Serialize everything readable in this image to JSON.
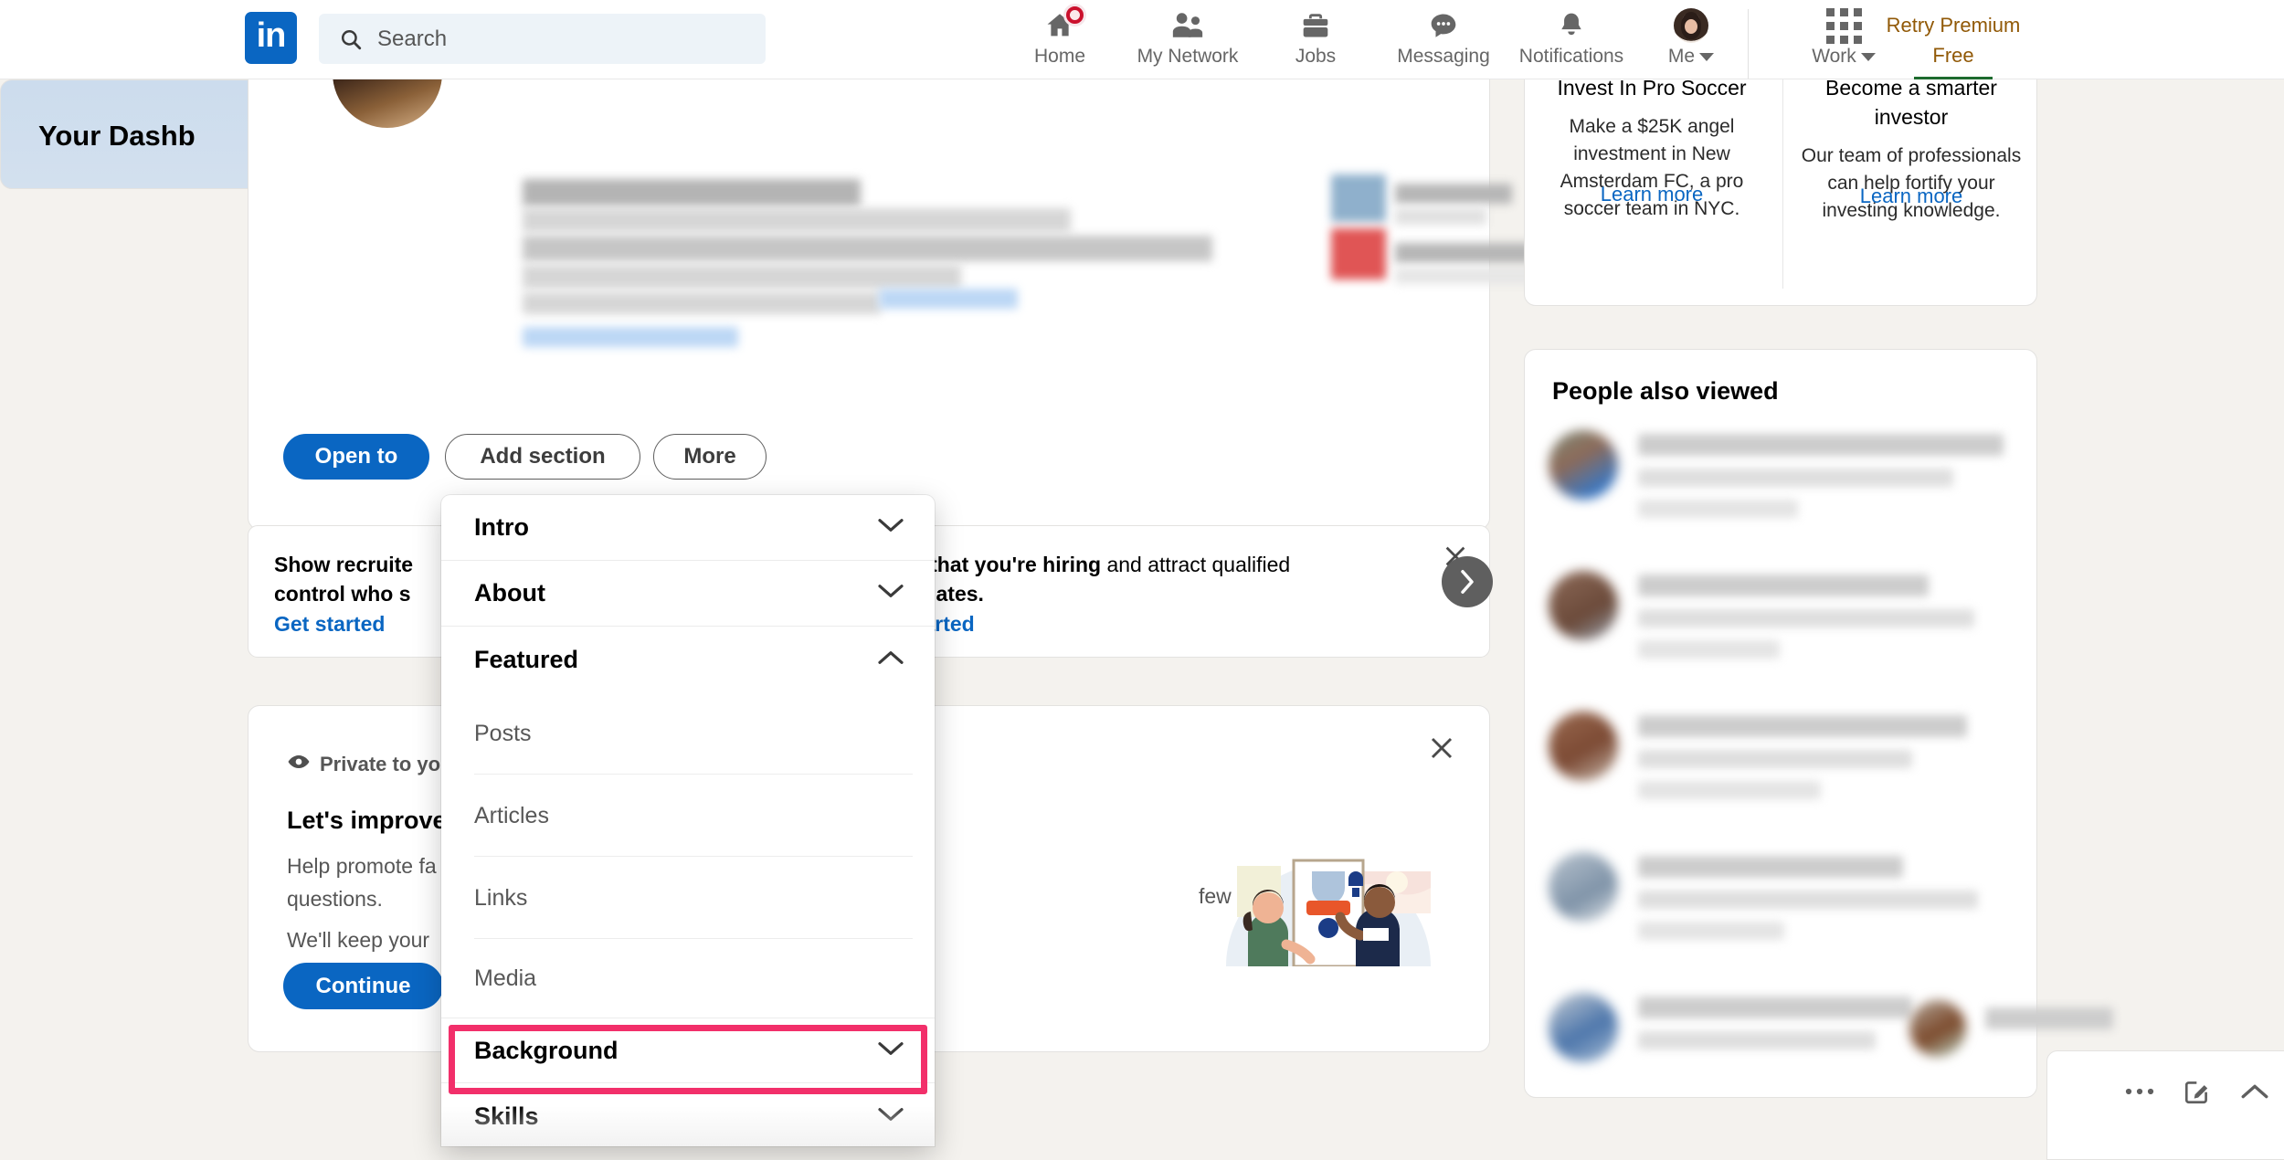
{
  "nav": {
    "logo_text": "in",
    "search": {
      "placeholder": "Search",
      "value": "",
      "icon": "search-icon"
    },
    "items": [
      {
        "label": "Home",
        "icon": "home-icon",
        "badge": true
      },
      {
        "label": "My Network",
        "icon": "people-icon",
        "badge": false
      },
      {
        "label": "Jobs",
        "icon": "briefcase-icon",
        "badge": false
      },
      {
        "label": "Messaging",
        "icon": "message-bubble-icon",
        "badge": false
      },
      {
        "label": "Notifications",
        "icon": "bell-icon",
        "badge": false
      }
    ],
    "me": {
      "label": "Me",
      "icon": "avatar-icon"
    },
    "work": {
      "label": "Work",
      "icon": "app-grid-icon"
    },
    "premium": {
      "line1": "Retry Premium",
      "line2": "Free"
    }
  },
  "profile": {
    "edit_icon": "pencil-icon",
    "buttons": {
      "open_to": "Open to",
      "add_section": "Add section",
      "more": "More"
    }
  },
  "promo_strip": {
    "left": {
      "text_bold": "Show recruite",
      "text_line2": "control who s",
      "link": "Get started",
      "icon": "close-icon"
    },
    "right": {
      "text_bold": "re that you're hiring",
      "text_rest": " and attract qualified",
      "text_line2": "didates.",
      "link": "started",
      "icon": "close-icon"
    },
    "next_icon": "chevron-right-icon"
  },
  "demographic": {
    "privacy": "Private to yo",
    "privacy_icon": "eye-icon",
    "heading": "Let's improve",
    "body_line1": "Help promote fa",
    "body_line2": "questions.",
    "body_line3": "We'll keep your",
    "body_right": "few demographic",
    "continue": "Continue",
    "close_icon": "close-icon",
    "illustration": "people-with-poster-illustration"
  },
  "dashboard": {
    "title": "Your Dashb"
  },
  "dropdown": {
    "sections": [
      {
        "label": "Intro",
        "type": "section",
        "chevron": "chevron-down-icon",
        "expanded": false
      },
      {
        "label": "About",
        "type": "section",
        "chevron": "chevron-down-icon",
        "expanded": false
      },
      {
        "label": "Featured",
        "type": "section",
        "chevron": "chevron-up-icon",
        "expanded": true
      },
      {
        "label": "Posts",
        "type": "sub"
      },
      {
        "label": "Articles",
        "type": "sub"
      },
      {
        "label": "Links",
        "type": "sub"
      },
      {
        "label": "Media",
        "type": "sub",
        "highlighted": true
      },
      {
        "label": "Background",
        "type": "section",
        "chevron": "chevron-down-icon",
        "expanded": false
      },
      {
        "label": "Skills",
        "type": "section",
        "chevron": "chevron-down-icon",
        "expanded": false
      }
    ],
    "highlight_color": "#f22f6a"
  },
  "right_rail": {
    "ads": [
      {
        "title": "Invest In Pro Soccer",
        "body": "Make a $25K angel investment in New Amsterdam FC, a pro soccer team in NYC.",
        "link": "Learn more"
      },
      {
        "title": "Become a smarter investor",
        "body": "Our team of professionals can help fortify your investing knowledge.",
        "link": "Learn more"
      }
    ],
    "people_also_viewed": {
      "title": "People also viewed"
    }
  },
  "messaging_bar": {
    "icons": [
      "more-options-icon",
      "compose-message-icon",
      "chevron-up-icon"
    ]
  },
  "colors": {
    "brand_blue": "#0a66c2",
    "premium_gold": "#915907",
    "highlight_pink": "#f22f6a",
    "page_bg": "#f4f2ee"
  }
}
